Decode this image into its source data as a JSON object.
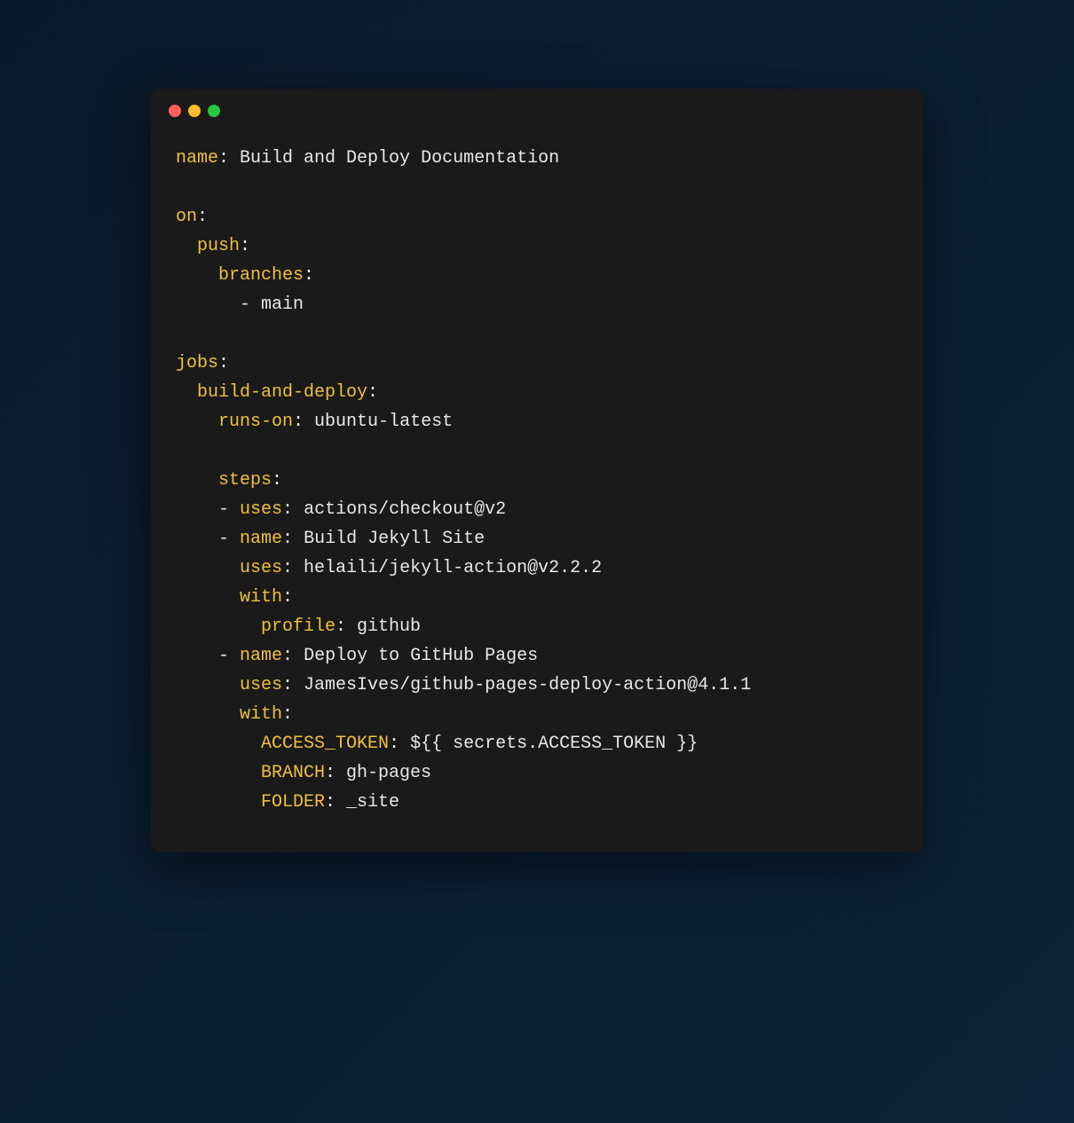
{
  "code": {
    "line1_key": "name",
    "line1_val": "Build and Deploy Documentation",
    "line2_key": "on",
    "line3_key": "push",
    "line4_key": "branches",
    "line5_val": "- main",
    "line6_key": "jobs",
    "line7_key": "build-and-deploy",
    "line8_key": "runs-on",
    "line8_val": "ubuntu-latest",
    "line9_key": "steps",
    "line10_dash": "- ",
    "line10_key": "uses",
    "line10_val": "actions/checkout@v2",
    "line11_dash": "- ",
    "line11_key": "name",
    "line11_val": "Build Jekyll Site",
    "line12_key": "uses",
    "line12_val": "helaili/jekyll-action@v2.2.2",
    "line13_key": "with",
    "line14_key": "profile",
    "line14_val": "github",
    "line15_dash": "- ",
    "line15_key": "name",
    "line15_val": "Deploy to GitHub Pages",
    "line16_key": "uses",
    "line16_val": "JamesIves/github-pages-deploy-action@4.1.1",
    "line17_key": "with",
    "line18_key": "ACCESS_TOKEN",
    "line18_val": "${{ secrets.ACCESS_TOKEN }}",
    "line19_key": "BRANCH",
    "line19_val": "gh-pages",
    "line20_key": "FOLDER",
    "line20_val": "_site"
  }
}
